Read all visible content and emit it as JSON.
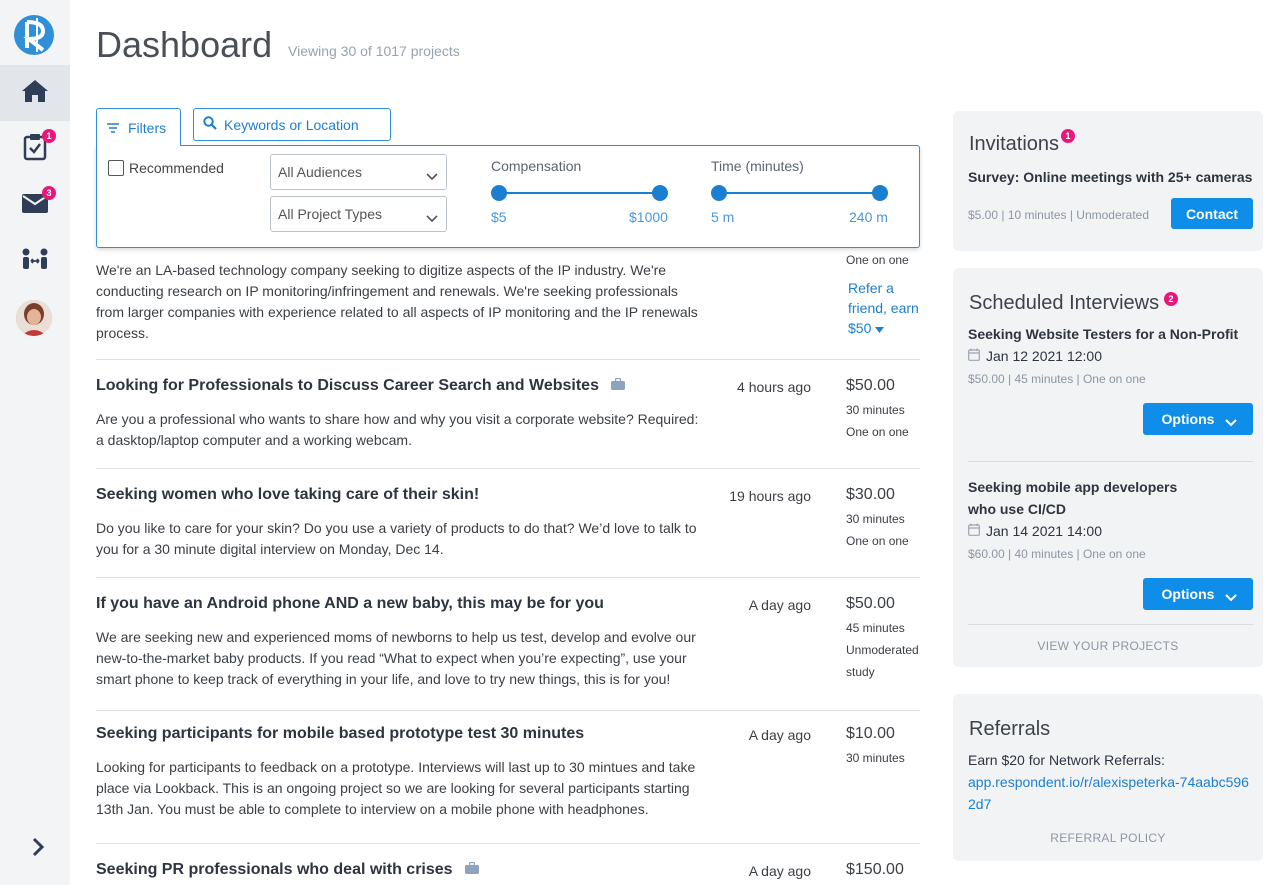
{
  "header": {
    "title": "Dashboard",
    "subtitle": "Viewing 30 of 1017 projects"
  },
  "sidebar": {
    "items": [
      {
        "name": "home",
        "badge": ""
      },
      {
        "name": "tasks",
        "badge": "1"
      },
      {
        "name": "messages",
        "badge": "3"
      },
      {
        "name": "referrals",
        "badge": ""
      }
    ]
  },
  "filters": {
    "tab_label": "Filters",
    "search_placeholder": "Keywords or Location",
    "recommended_label": "Recommended",
    "audience_select": "All Audiences",
    "project_type_select": "All Project Types",
    "compensation": {
      "label": "Compensation",
      "min_label": "$5",
      "max_label": "$1000"
    },
    "time": {
      "label": "Time (minutes)",
      "min_label": "5 m",
      "max_label": "240 m"
    }
  },
  "projects": {
    "first": {
      "description": "We're an LA-based technology company seeking to digitize aspects of the IP industry. We're conducting research on IP monitoring/infringement and renewals. We're seeking professionals from larger companies with experience related to all aspects of IP monitoring and the IP renewals process.",
      "format": "One on one",
      "refer_text": "Refer a friend, earn $50"
    },
    "items": [
      {
        "title": "Looking for Professionals to Discuss Career Search and Websites",
        "time": "4 hours ago",
        "price": "$50.00",
        "duration": "30 minutes",
        "format": "One on one",
        "description": "Are you a professional who wants to share how and why you visit a corporate website? Required: a dasktop/laptop computer and a working webcam."
      },
      {
        "title": "Seeking women who love taking care of their skin!",
        "time": "19 hours ago",
        "price": "$30.00",
        "duration": "30 minutes",
        "format": "One on one",
        "description": "Do you like to care for your skin? Do you use a variety of products to do that? We’d love to talk to you for a 30 minute digital interview on Monday, Dec 14."
      },
      {
        "title": "If you have an Android phone AND a new baby, this may be for you",
        "time": "A day ago",
        "price": "$50.00",
        "duration": "45 minutes",
        "format": "Unmoderated study",
        "description": "We are seeking new and experienced moms of newborns to help us test, develop and evolve our new-to-the-market baby products. If you read “What to expect when you’re expecting”, use your smart phone to keep track of everything in your life, and love to try new things, this is for you!"
      },
      {
        "title": "Seeking participants for mobile based prototype test 30 minutes",
        "time": "A day ago",
        "price": "$10.00",
        "duration": "30 minutes",
        "format": "",
        "description": "Looking for participants to feedback on a prototype. Interviews will last up to 30 mintues and take place via Lookback. This is an ongoing project so we are looking for several participants starting 13th Jan. You must be able to complete to interview on a mobile phone with headphones."
      },
      {
        "title": "Seeking PR professionals who deal with crises",
        "time": "A day ago",
        "price": "$150.00",
        "duration": "",
        "format": "",
        "description": ""
      }
    ]
  },
  "invitations": {
    "title": "Invitations",
    "badge": "1",
    "item_title": "Survey: Online meetings with 25+ cameras",
    "item_meta": "$5.00 | 10 minutes | Unmoderated",
    "button": "Contact"
  },
  "scheduled": {
    "title": "Scheduled Interviews",
    "badge": "2",
    "items": [
      {
        "title": "Seeking Website Testers for a Non-Profit",
        "date": "Jan 12 2021 12:00",
        "meta": "$50.00 | 45 minutes | One on one",
        "button": "Options"
      },
      {
        "title": "Seeking mobile app developers who use CI/CD",
        "date": "Jan 14 2021 14:00",
        "meta": "$60.00 | 40 minutes | One on one",
        "button": "Options"
      }
    ],
    "view_link": "VIEW YOUR PROJECTS"
  },
  "referrals": {
    "title": "Referrals",
    "text": "Earn $20 for Network Referrals:",
    "url": "app.respondent.io/r/alexispeterka-74aabc5962d7",
    "policy_link": "REFERRAL POLICY"
  },
  "colors": {
    "accent": "#0e8ee8",
    "badge": "#e8177c",
    "sidebar_bg": "#f3f4f6",
    "card_bg": "#f2f3f5"
  }
}
